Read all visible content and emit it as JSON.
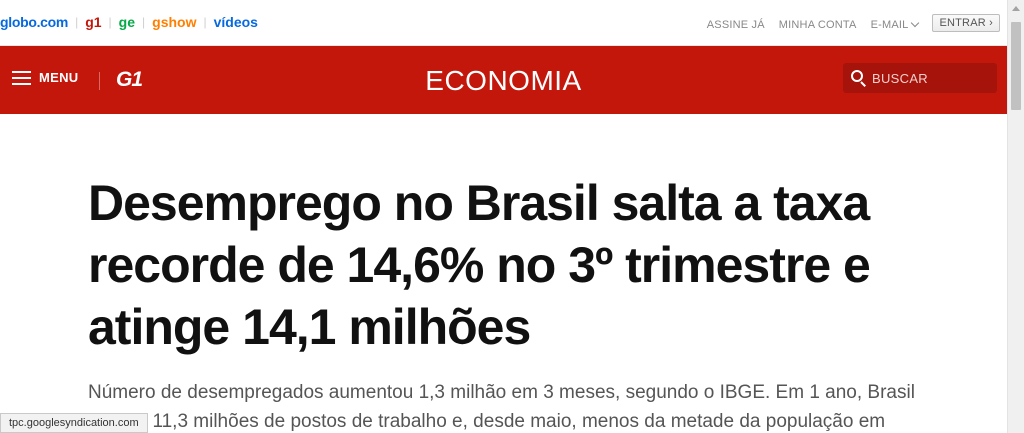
{
  "globo_bar": {
    "brands": [
      "globo.com",
      "g1",
      "ge",
      "gshow",
      "vídeos"
    ],
    "user_links": {
      "subscribe": "ASSINE JÁ",
      "account": "MINHA CONTA",
      "email": "E-MAIL",
      "login": "ENTRAR ›"
    }
  },
  "section_header": {
    "menu_label": "MENU",
    "logo": "G1",
    "title": "ECONOMIA",
    "search_placeholder": "BUSCAR"
  },
  "article": {
    "headline": "Desemprego no Brasil salta a taxa recorde de 14,6% no 3º trimestre e atinge 14,1 milhões",
    "subheadline": "Número de desempregados aumentou 1,3 milhão em 3 meses, segundo o IBGE. Em 1 ano, Brasil perdeu 11,3 milhões de postos de trabalho e, desde maio, menos da metade da população em"
  },
  "status_bar": {
    "url": "tpc.googlesyndication.com"
  },
  "colors": {
    "brand_red": "#c4170c",
    "globo_blue": "#0669de",
    "ge_green": "#06aa48",
    "gshow_orange": "#ff7f00"
  }
}
